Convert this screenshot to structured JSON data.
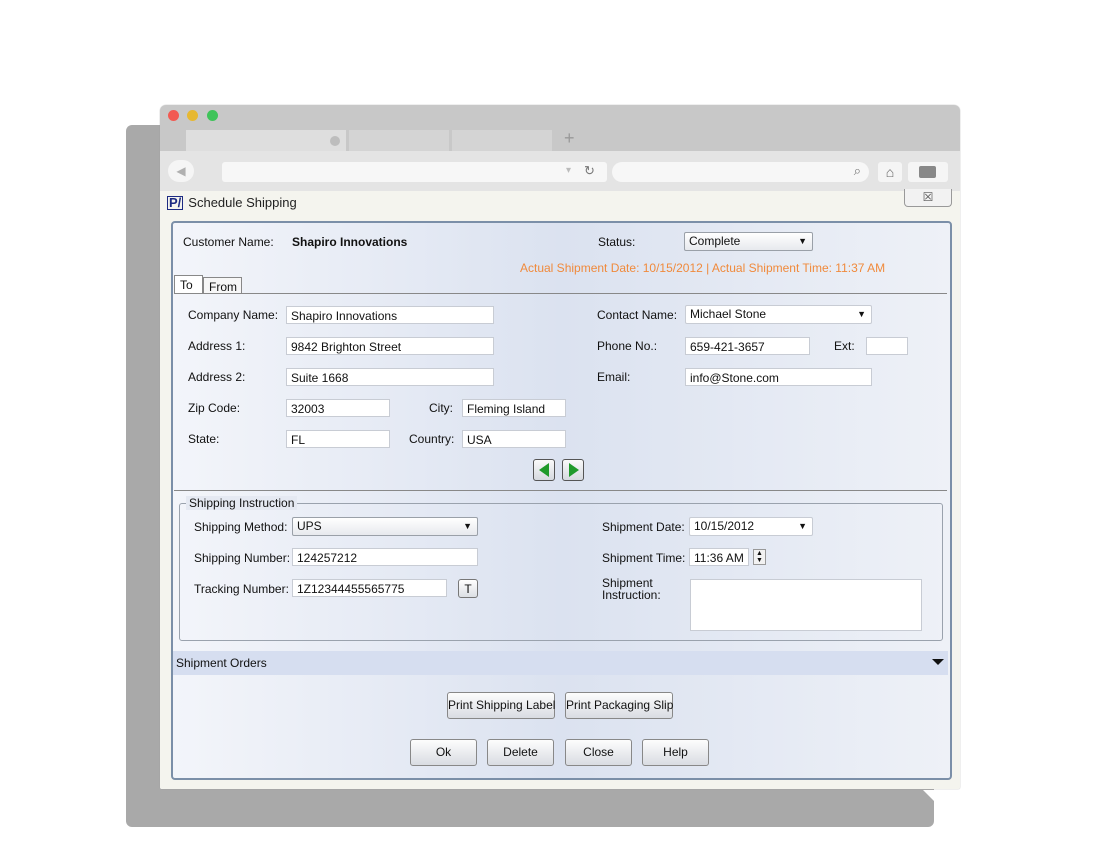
{
  "app": {
    "title": "Schedule Shipping",
    "logo_text": "P/",
    "close_glyph": "☒"
  },
  "header": {
    "customer_label": "Customer Name:",
    "customer_value": "Shapiro Innovations",
    "status_label": "Status:",
    "status_value": "Complete",
    "actual_shipment": "Actual Shipment Date: 10/15/2012 | Actual Shipment Time: 11:37 AM"
  },
  "tabs": [
    {
      "label": "To",
      "active": true
    },
    {
      "label": "From",
      "active": false
    }
  ],
  "address": {
    "company_label": "Company Name:",
    "company_value": "Shapiro Innovations",
    "address1_label": "Address 1:",
    "address1_value": "9842 Brighton Street",
    "address2_label": "Address 2:",
    "address2_value": "Suite 1668",
    "zip_label": "Zip Code:",
    "zip_value": "32003",
    "city_label": "City:",
    "city_value": "Fleming Island",
    "state_label": "State:",
    "state_value": "FL",
    "country_label": "Country:",
    "country_value": "USA",
    "contact_label": "Contact Name:",
    "contact_value": "Michael Stone",
    "phone_label": "Phone No.:",
    "phone_value": "659-421-3657",
    "ext_label": "Ext:",
    "ext_value": "",
    "email_label": "Email:",
    "email_value": "info@Stone.com"
  },
  "shipping": {
    "group_label": "Shipping Instruction",
    "method_label": "Shipping Method:",
    "method_value": "UPS",
    "number_label": "Shipping Number:",
    "number_value": "124257212",
    "tracking_label": "Tracking Number:",
    "tracking_value": "1Z12344455565775",
    "tracking_button": "T",
    "date_label": "Shipment Date:",
    "date_value": "10/15/2012",
    "time_label": "Shipment Time:",
    "time_value": "11:36 AM",
    "instruction_label_1": "Shipment",
    "instruction_label_2": "Instruction:",
    "instruction_value": ""
  },
  "orders": {
    "label": "Shipment Orders"
  },
  "buttons": {
    "print_label": "Print Shipping Label",
    "print_slip": "Print Packaging Slip",
    "ok": "Ok",
    "delete": "Delete",
    "close": "Close",
    "help": "Help"
  },
  "browser": {
    "new_tab": "+",
    "back": "◀",
    "reload": "↻",
    "dropdown": "▾",
    "search": "⌕",
    "home": "⌂"
  },
  "colors": {
    "accent_orange": "#f08a3c",
    "nav_green": "#1f9a2a",
    "dialog_border": "#7b8fa8"
  }
}
